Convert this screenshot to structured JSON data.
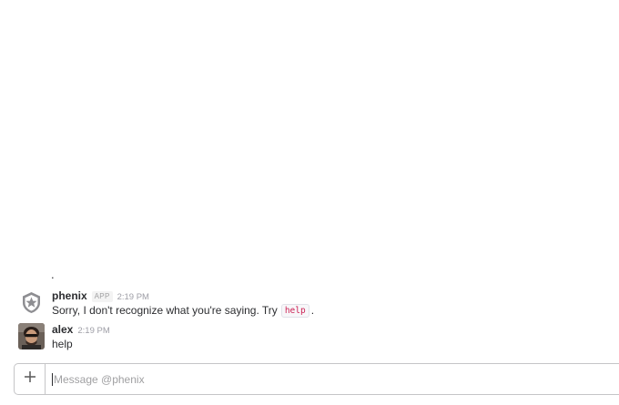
{
  "messages": {
    "stray_text": ".",
    "items": [
      {
        "sender": "phenix",
        "badge": "APP",
        "time": "2:19 PM",
        "text_before": "Sorry, I don't recognize what you're saying. Try",
        "code": "help",
        "text_after": ".",
        "avatar_icon": "bot-shield-icon"
      },
      {
        "sender": "alex",
        "time": "2:19 PM",
        "text": "help",
        "avatar_icon": "user-photo-avatar"
      }
    ]
  },
  "composer": {
    "attach_icon": "plus-icon",
    "placeholder": "Message @phenix",
    "value": ""
  },
  "colors": {
    "text": "#2c2d30",
    "muted": "#9e9ea6",
    "code_text": "#cc2255",
    "border": "#c5c5c7"
  }
}
